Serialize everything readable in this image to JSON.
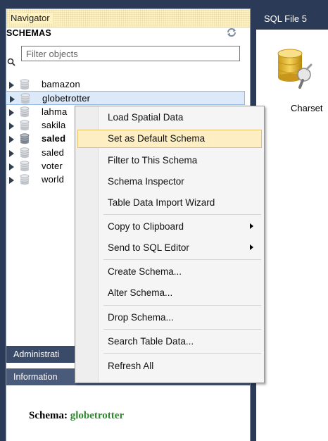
{
  "navigator": {
    "title": "Navigator",
    "schemas_label": "SCHEMAS",
    "filter_placeholder": "Filter objects",
    "schemas": [
      {
        "name": "bamazon",
        "bold": false,
        "selected": false
      },
      {
        "name": "globetrotter",
        "bold": false,
        "selected": true
      },
      {
        "name": "lahma",
        "bold": false,
        "selected": false
      },
      {
        "name": "sakila",
        "bold": false,
        "selected": false
      },
      {
        "name": "saled",
        "bold": true,
        "selected": false
      },
      {
        "name": "saled",
        "bold": false,
        "selected": false
      },
      {
        "name": "voter",
        "bold": false,
        "selected": false
      },
      {
        "name": "world",
        "bold": false,
        "selected": false
      }
    ]
  },
  "tabs": {
    "administration": "Administrati",
    "information": "Information"
  },
  "info": {
    "schema_label": "Schema:",
    "schema_value": "globetrotter"
  },
  "editor": {
    "tab_title": "SQL File 5",
    "icon_label": "Charset"
  },
  "context_menu": {
    "items": [
      {
        "label": "Load Spatial Data",
        "submenu": false
      },
      {
        "label": "Set as Default Schema",
        "submenu": false,
        "highlighted": true
      },
      {
        "label": "Filter to This Schema",
        "submenu": false
      },
      {
        "label": "Schema Inspector",
        "submenu": false
      },
      {
        "label": "Table Data Import Wizard",
        "submenu": false
      },
      {
        "label": "Copy to Clipboard",
        "submenu": true
      },
      {
        "label": "Send to SQL Editor",
        "submenu": true
      },
      {
        "label": "Create Schema...",
        "submenu": false
      },
      {
        "label": "Alter Schema...",
        "submenu": false
      },
      {
        "label": "Drop Schema...",
        "submenu": false
      },
      {
        "label": "Search Table Data...",
        "submenu": false
      },
      {
        "label": "Refresh All",
        "submenu": false
      }
    ]
  },
  "colors": {
    "frame": "#2b3b57",
    "header_bg": "#fff3c4",
    "selection": "#dbe9f8",
    "menu_highlight": "#fdefc3",
    "schema_value": "#2a8a2a"
  }
}
